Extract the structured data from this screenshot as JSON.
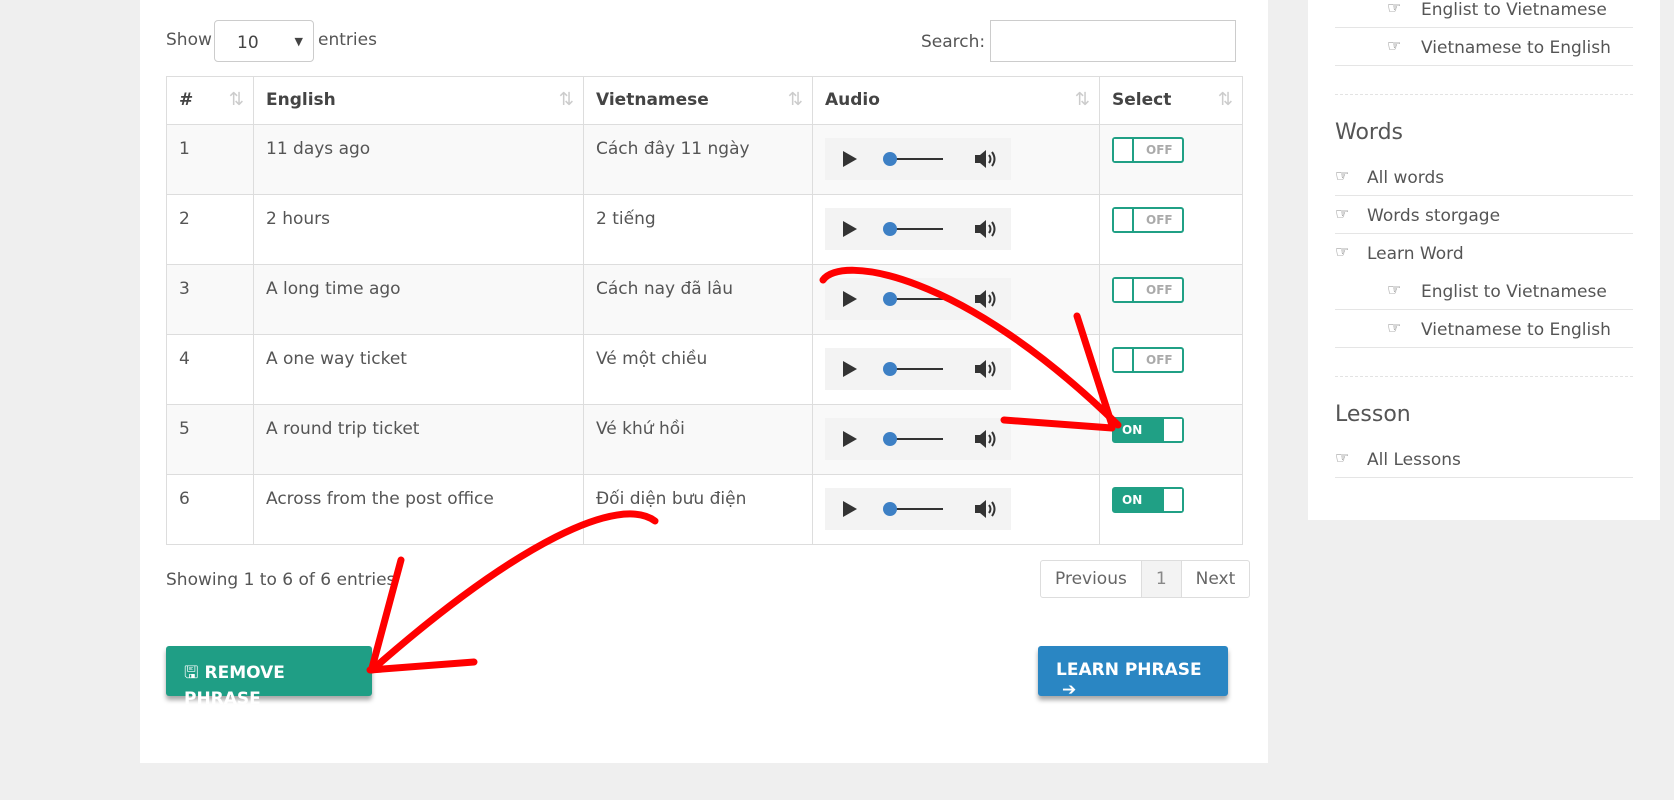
{
  "controls": {
    "show_label": "Show",
    "length_value": "10",
    "entries_label": "entries",
    "search_label": "Search:",
    "search_value": ""
  },
  "table": {
    "headers": [
      "#",
      "English",
      "Vietnamese",
      "Audio",
      "Select"
    ],
    "rows": [
      {
        "num": "1",
        "english": "11 days ago",
        "vietnamese": "Cách đây 11 ngày",
        "select": "OFF"
      },
      {
        "num": "2",
        "english": "2 hours",
        "vietnamese": "2 tiếng",
        "select": "OFF"
      },
      {
        "num": "3",
        "english": "A long time ago",
        "vietnamese": "Cách nay đã lâu",
        "select": "OFF"
      },
      {
        "num": "4",
        "english": "A one way ticket",
        "vietnamese": "Vé một chiều",
        "select": "OFF"
      },
      {
        "num": "5",
        "english": "A round trip ticket",
        "vietnamese": "Vé khứ hồi",
        "select": "ON"
      },
      {
        "num": "6",
        "english": "Across from the post office",
        "vietnamese": "Đối diện bưu điện",
        "select": "ON"
      }
    ]
  },
  "footer": {
    "info": "Showing 1 to 6 of 6 entries",
    "prev": "Previous",
    "page": "1",
    "next": "Next"
  },
  "buttons": {
    "remove": "REMOVE PHRASE",
    "learn": "LEARN PHRASE"
  },
  "sidebar": {
    "top_items": [
      "Englist to Vietnamese",
      "Vietnamese to English"
    ],
    "words_title": "Words",
    "words_items": [
      "All words",
      "Words storgage",
      "Learn Word"
    ],
    "words_sub": [
      "Englist to Vietnamese",
      "Vietnamese to English"
    ],
    "lesson_title": "Lesson",
    "lesson_items": [
      "All Lessons"
    ]
  },
  "icons": {
    "play": "play-icon",
    "volume": "volume-icon",
    "hand": "hand-pointer-icon",
    "save": "save-icon",
    "arrow": "arrow-right-icon"
  },
  "colors": {
    "green": "#20a085",
    "blue": "#2a86c3",
    "annotation": "#ff0000"
  }
}
